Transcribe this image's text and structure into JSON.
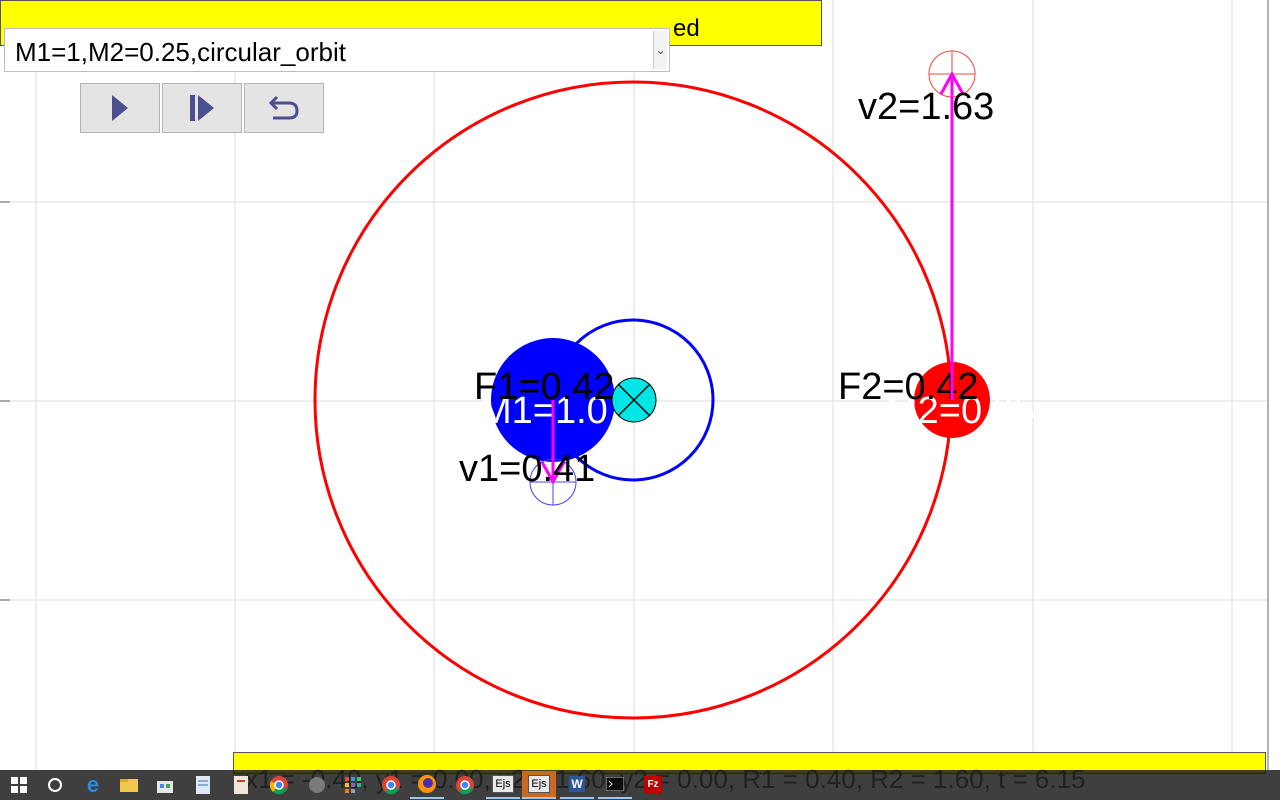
{
  "window": {
    "preset_select": {
      "value": "M1=1,M2=0.25,circular_orbit"
    },
    "top_message": "ed",
    "status_bar": "x1 = -0.40, y1 = 0.00, x2 = 1.60, y2 = 0.00, R1 = 0.40, R2 = 1.60, t = 6.15"
  },
  "toolbar": [
    {
      "name": "play-button",
      "icon": "play-icon"
    },
    {
      "name": "step-button",
      "icon": "step-forward-icon"
    },
    {
      "name": "reset-button",
      "icon": "reset-icon"
    }
  ],
  "simulation": {
    "center_of_mass_label": "",
    "body1": {
      "label": "M1=1.0",
      "force_label": "F1=0.42",
      "velocity_label": "v1=0.41",
      "color": "#0000ff"
    },
    "body2": {
      "label": "M2=0.25",
      "force_label": "F2=0.42",
      "velocity_label": "v2=1.63",
      "color": "#ff0000"
    },
    "orbit_colors": {
      "body1": "#0000ff",
      "body2": "#ff0000"
    },
    "vector_color": "#ff00ff",
    "center_of_mass_color": "#00e5e5"
  },
  "taskbar": {
    "items": [
      {
        "name": "windows-start-button",
        "icon": "windows-logo-icon"
      },
      {
        "name": "search-button",
        "icon": "cortana-search-icon"
      },
      {
        "name": "edge-taskbar-item",
        "icon": "edge-icon"
      },
      {
        "name": "file-explorer-taskbar-item",
        "icon": "folder-icon"
      },
      {
        "name": "store-taskbar-item",
        "icon": "store-icon"
      },
      {
        "name": "notepad-taskbar-item",
        "icon": "document-icon"
      },
      {
        "name": "chrome-taskbar-item",
        "icon": "chrome-icon"
      },
      {
        "name": "app-taskbar-item-7",
        "icon": "app-icon"
      },
      {
        "name": "app-taskbar-item-8",
        "icon": "document-icon"
      },
      {
        "name": "chrome-taskbar-item-2",
        "icon": "chrome-icon"
      },
      {
        "name": "app-grid-taskbar-item",
        "icon": "grid-icon"
      },
      {
        "name": "chrome-taskbar-item-3",
        "icon": "chrome-icon"
      },
      {
        "name": "firefox-taskbar-item",
        "icon": "firefox-icon"
      },
      {
        "name": "ejs-taskbar-item-1",
        "icon": "ejs-icon",
        "text": "Ejs"
      },
      {
        "name": "ejs-taskbar-item-2",
        "icon": "ejs-icon",
        "text": "Ejs"
      },
      {
        "name": "word-taskbar-item",
        "icon": "word-icon",
        "text": "W"
      },
      {
        "name": "cmd-taskbar-item",
        "icon": "terminal-icon"
      },
      {
        "name": "filezilla-taskbar-item",
        "icon": "filezilla-icon",
        "text": "Fz"
      }
    ]
  }
}
